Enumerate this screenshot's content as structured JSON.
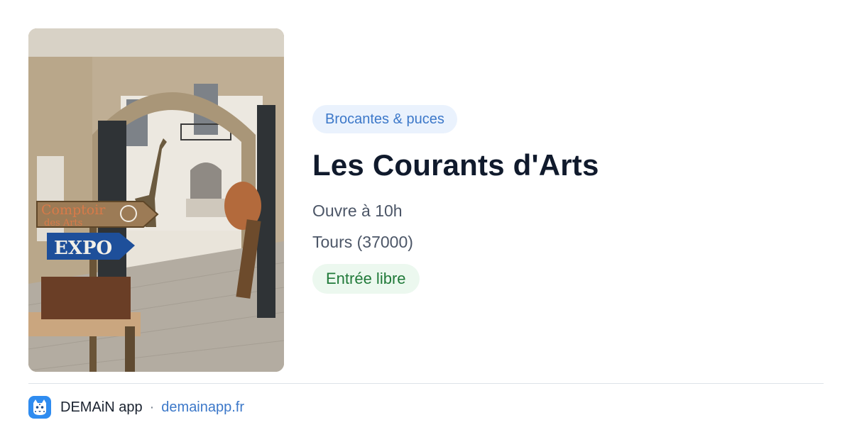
{
  "card": {
    "image_alt": "Cour pavée sous une arche en pierre avec panneaux Comptoir des Arts et EXPO",
    "photo_sign_1": "Comptoir des Arts",
    "photo_sign_2": "EXPO",
    "category": "Brocantes & puces",
    "title": "Les Courants d'Arts",
    "opening": "Ouvre à 10h",
    "location": "Tours (37000)",
    "entry": "Entrée libre"
  },
  "footer": {
    "app_icon": "leopard-app-icon",
    "app_name": "DEMAiN app",
    "separator": "·",
    "domain": "demainapp.fr"
  },
  "colors": {
    "category_bg": "#eaf2fd",
    "category_text": "#3c78c9",
    "entry_bg": "#ecf8ef",
    "entry_text": "#217a3a",
    "title": "#101a2c",
    "link": "#3c78c9",
    "app_icon_bg": "#2f8cf0"
  }
}
